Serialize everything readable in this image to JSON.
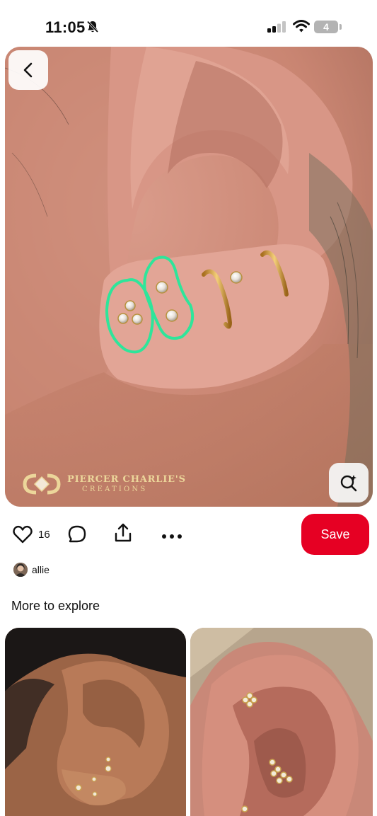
{
  "status_bar": {
    "time": "11:05",
    "battery_level": "4"
  },
  "pin": {
    "watermark_title": "PIERCER CHARLIE'S",
    "watermark_subtitle": "CREATIONS",
    "annotation_color": "#2ee59a"
  },
  "actions": {
    "like_count": "16",
    "save_label": "Save"
  },
  "author": {
    "name": "allie"
  },
  "section": {
    "title": "More to explore"
  },
  "colors": {
    "accent": "#e60023",
    "battery": "#b3b3b3"
  },
  "icons": [
    "bell-slash-icon",
    "signal-icon",
    "wifi-icon",
    "battery-icon",
    "chevron-left-icon",
    "visual-search-icon",
    "heart-icon",
    "comment-icon",
    "share-icon",
    "more-icon"
  ]
}
